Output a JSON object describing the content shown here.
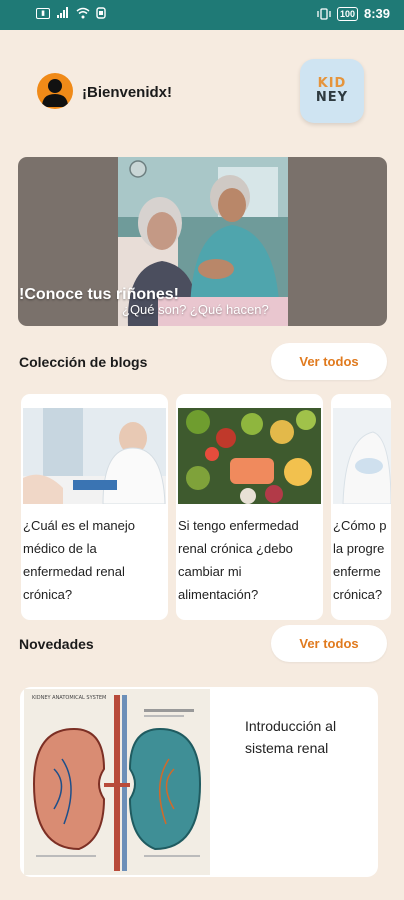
{
  "status_bar": {
    "time": "8:39",
    "battery": "100",
    "left_icons": [
      "sim-icon",
      "signal-icon",
      "wifi-icon",
      "notification-icon"
    ],
    "right_icons": [
      "vibrate-icon",
      "battery-icon"
    ]
  },
  "header": {
    "greeting": "¡Bienvenidx!",
    "logo_line1": "KID",
    "logo_line2": "NEY"
  },
  "hero": {
    "title": "!Conoce tus riñones!",
    "subtitle": "¿Qué son? ¿Qué hacen?"
  },
  "blogs": {
    "section_title": "Colección de blogs",
    "see_all_label": "Ver todos",
    "cards": [
      {
        "text": "¿Cuál es el manejo médico de la enfermedad renal crónica?"
      },
      {
        "text": "Si tengo enfermedad renal crónica ¿debo cambiar mi alimentación?"
      },
      {
        "text": "¿Cómo p la progre enferme crónica?"
      }
    ]
  },
  "news": {
    "section_title": "Novedades",
    "see_all_label": "Ver todos",
    "items": [
      {
        "title": "Introducción al sistema renal",
        "image_caption": "KIDNEY ANATOMICAL SYSTEM"
      }
    ]
  },
  "colors": {
    "background": "#f6ebe0",
    "status_bar": "#1f7a76",
    "accent": "#e07a1e",
    "avatar": "#f08a18",
    "logo_bg": "#cfe4f2",
    "hero_bg": "#7a716b"
  }
}
